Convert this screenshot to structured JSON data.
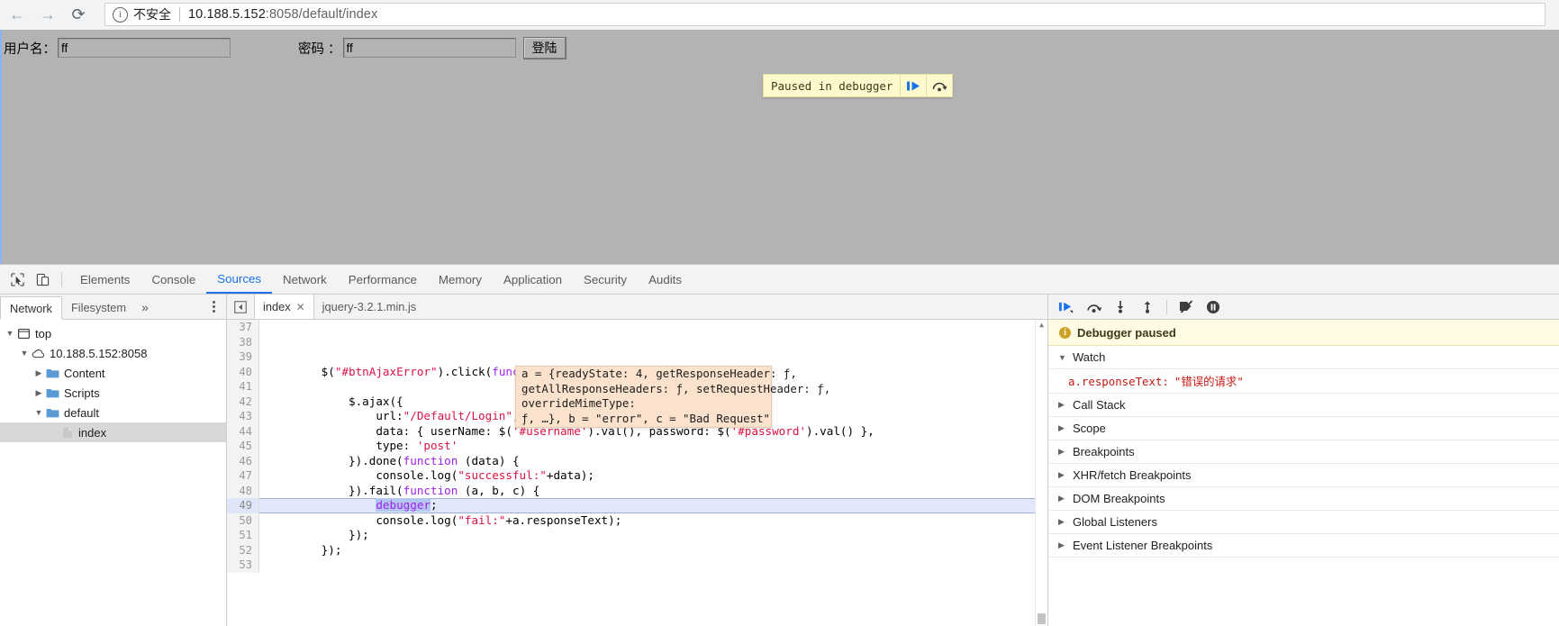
{
  "browser": {
    "back_icon": "arrow-left-icon",
    "forward_icon": "arrow-right-icon",
    "reload_icon": "reload-icon",
    "security_label": "不安全",
    "info_glyph": "i",
    "url_host": "10.188.5.152",
    "url_rest": ":8058/default/index"
  },
  "page": {
    "username_label": "用户名：",
    "username_value": "ff",
    "password_label": "密码 ：",
    "password_value": "ff",
    "login_button": "登陆"
  },
  "paused_overlay": {
    "text": "Paused in debugger",
    "resume_icon": "resume-script-icon",
    "step_over_icon": "step-over-icon"
  },
  "devtools": {
    "inspect_icon": "inspect-element-icon",
    "device_icon": "toggle-device-toolbar-icon",
    "tabs": [
      {
        "label": "Elements",
        "active": false
      },
      {
        "label": "Console",
        "active": false
      },
      {
        "label": "Sources",
        "active": true
      },
      {
        "label": "Network",
        "active": false
      },
      {
        "label": "Performance",
        "active": false
      },
      {
        "label": "Memory",
        "active": false
      },
      {
        "label": "Application",
        "active": false
      },
      {
        "label": "Security",
        "active": false
      },
      {
        "label": "Audits",
        "active": false
      }
    ]
  },
  "navigator": {
    "tabs": [
      {
        "label": "Network",
        "active": true
      },
      {
        "label": "Filesystem",
        "active": false
      }
    ],
    "more_glyph": "»",
    "kebab_icon": "more-options-icon",
    "tree": [
      {
        "label": "top",
        "depth": 0,
        "twisty": "▼",
        "icon": "frame-icon"
      },
      {
        "label": "10.188.5.152:8058",
        "depth": 1,
        "twisty": "▼",
        "icon": "cloud-icon"
      },
      {
        "label": "Content",
        "depth": 2,
        "twisty": "▶",
        "icon": "folder-icon"
      },
      {
        "label": "Scripts",
        "depth": 2,
        "twisty": "▶",
        "icon": "folder-icon"
      },
      {
        "label": "default",
        "depth": 2,
        "twisty": "▼",
        "icon": "folder-icon"
      },
      {
        "label": "index",
        "depth": 3,
        "twisty": "",
        "icon": "file-icon",
        "selected": true
      }
    ]
  },
  "editor": {
    "panel_toggle_icon": "show-navigator-icon",
    "tabs": [
      {
        "label": "index",
        "active": true,
        "closable": true,
        "close_glyph": "✕"
      },
      {
        "label": "jquery-3.2.1.min.js",
        "active": false,
        "closable": false
      }
    ],
    "first_line": 37,
    "lines": [
      {
        "n": 37,
        "text": ""
      },
      {
        "n": 38,
        "text": ""
      },
      {
        "n": 39,
        "text": ""
      },
      {
        "n": 40,
        "text": "        $(\"#btnAjaxError\").click(function () {"
      },
      {
        "n": 41,
        "text": ""
      },
      {
        "n": 42,
        "text": "            $.ajax({"
      },
      {
        "n": 43,
        "text": "                url:\"/Default/Login\","
      },
      {
        "n": 44,
        "text": "                data: { userName: $('#username').val(), password: $('#password').val() },"
      },
      {
        "n": 45,
        "text": "                type: 'post'"
      },
      {
        "n": 46,
        "text": "            }).done(function (data) {"
      },
      {
        "n": 47,
        "text": "                console.log(\"successful:\"+data);"
      },
      {
        "n": 48,
        "text": "            }).fail(function (a, b, c) {"
      },
      {
        "n": 49,
        "text": "                debugger;",
        "paused": true
      },
      {
        "n": 50,
        "text": "                console.log(\"fail:\"+a.responseText);"
      },
      {
        "n": 51,
        "text": "            });"
      },
      {
        "n": 52,
        "text": "        });"
      },
      {
        "n": 53,
        "text": ""
      }
    ],
    "value_popup": [
      "a = {readyState: 4, getResponseHeader: ƒ,",
      "getAllResponseHeaders: ƒ, setRequestHeader: ƒ,",
      "overrideMimeType:",
      "ƒ, …}, b = \"error\", c = \"Bad Request\""
    ],
    "scroll_up_glyph": "▲"
  },
  "debugger_panel": {
    "toolbar": [
      {
        "name": "resume-script-execution",
        "icon": "resume-icon"
      },
      {
        "name": "step-over-next-function-call",
        "icon": "step-over-icon"
      },
      {
        "name": "step-into-next-function-call",
        "icon": "step-into-icon"
      },
      {
        "name": "step-out-of-current-function",
        "icon": "step-out-icon"
      },
      {
        "name": "deactivate-breakpoints",
        "icon": "deactivate-breakpoints-icon"
      },
      {
        "name": "pause-on-exceptions",
        "icon": "pause-on-exceptions-icon"
      }
    ],
    "status": "Debugger paused",
    "status_icon": "info-icon",
    "sections": [
      {
        "label": "Watch",
        "expanded": true,
        "caret": "▼"
      },
      {
        "label": "Call Stack",
        "expanded": false,
        "caret": "▶"
      },
      {
        "label": "Scope",
        "expanded": false,
        "caret": "▶"
      },
      {
        "label": "Breakpoints",
        "expanded": false,
        "caret": "▶"
      },
      {
        "label": "XHR/fetch Breakpoints",
        "expanded": false,
        "caret": "▶"
      },
      {
        "label": "DOM Breakpoints",
        "expanded": false,
        "caret": "▶"
      },
      {
        "label": "Global Listeners",
        "expanded": false,
        "caret": "▶"
      },
      {
        "label": "Event Listener Breakpoints",
        "expanded": false,
        "caret": "▶"
      }
    ],
    "watch_entries": [
      {
        "expression": "a.responseText:",
        "value": "\"错误的请求\""
      }
    ]
  },
  "colors": {
    "accent": "#1a73e8",
    "paused_banner_bg": "#fffacd",
    "popup_bg": "#fbe2cd",
    "paused_line_bg": "#e2e8fa",
    "page_bg": "#b3b3b3"
  }
}
